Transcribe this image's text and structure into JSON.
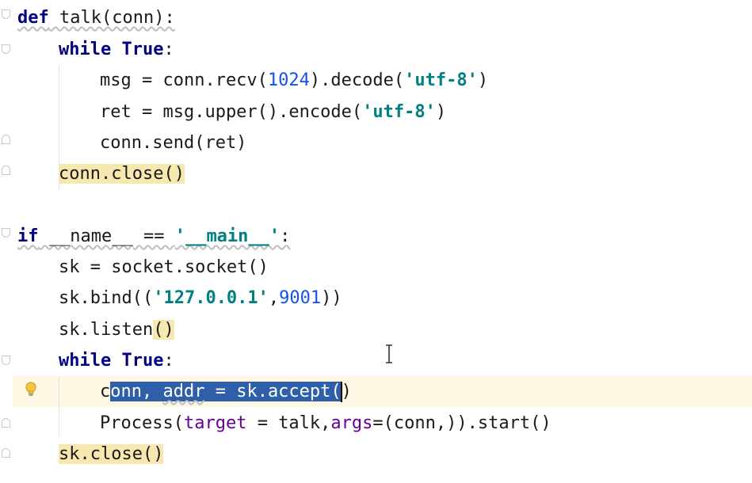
{
  "code": {
    "l1": {
      "def_kw": "def",
      "rest": " talk(conn):"
    },
    "l2": {
      "while_kw": "while",
      "true_kw": "True",
      "colon": ":"
    },
    "l3": {
      "a": "msg = conn.recv(",
      "num": "1024",
      "b": ").decode(",
      "str": "'utf-8'",
      "c": ")"
    },
    "l4": {
      "a": "ret = msg.upper().encode(",
      "str": "'utf-8'",
      "c": ")"
    },
    "l5": {
      "text": "conn.send(ret)"
    },
    "l6": {
      "text": "conn.close()"
    },
    "l7": {
      "if_kw": "if",
      "name": " __name__",
      "eq": " == ",
      "str": "'__main__'",
      "colon": ":"
    },
    "l8": {
      "text": "sk = socket.socket()"
    },
    "l9": {
      "a": "sk.bind((",
      "str": "'127.0.0.1'",
      "comma": ",",
      "num": "9001",
      "c": "))"
    },
    "l10": {
      "a": "sk.listen",
      "paren": "()"
    },
    "l11": {
      "while_kw": "while",
      "true_kw": "True",
      "colon": ":"
    },
    "l12": {
      "pre": "c",
      "sel_a": "onn, ",
      "sel_addr": "addr",
      "sel_b": " = sk.accept(",
      "post": ")"
    },
    "l13": {
      "a": "Process(",
      "target": "target",
      "b": " = talk,",
      "args": "args",
      "c": "=(conn,)).start()"
    },
    "l14": {
      "text": "sk.close()"
    }
  },
  "icons": {
    "bulb": "lightbulb-icon",
    "cursor": "text-cursor-icon"
  },
  "colors": {
    "keyword": "#000080",
    "string": "#008080",
    "number": "#1750eb",
    "parameter": "#660099",
    "selection": "#2f5fa8",
    "highlight": "#f7e8b0",
    "caret_row": "#fdf7e3"
  }
}
